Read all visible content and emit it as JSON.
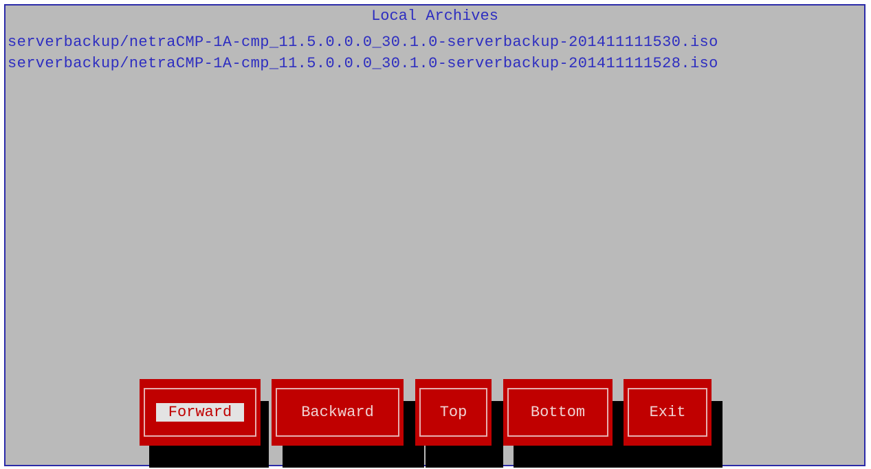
{
  "screen": {
    "title": "Local Archives",
    "archives": [
      "serverbackup/netraCMP-1A-cmp_11.5.0.0.0_30.1.0-serverbackup-201411111530.iso",
      "serverbackup/netraCMP-1A-cmp_11.5.0.0.0_30.1.0-serverbackup-201411111528.iso"
    ],
    "buttons": {
      "forward": "Forward",
      "backward": "Backward",
      "top": "Top",
      "bottom": "Bottom",
      "exit": "Exit"
    },
    "focused_button": "Forward",
    "colors": {
      "background": "#bababa",
      "border": "#2a2aa8",
      "text": "#2e2ec0",
      "button": "#c00000",
      "button_text": "#f0d2d2",
      "shadow": "#000000"
    }
  }
}
